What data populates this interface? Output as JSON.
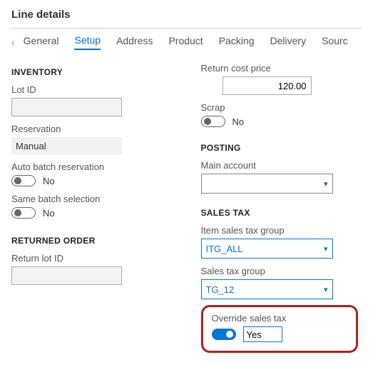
{
  "header": {
    "title": "Line details"
  },
  "tabs": {
    "items": [
      "General",
      "Setup",
      "Address",
      "Product",
      "Packing",
      "Delivery",
      "Sourc"
    ],
    "active_index": 1
  },
  "left": {
    "inventory": {
      "heading": "INVENTORY",
      "lot_id_label": "Lot ID",
      "lot_id_value": "",
      "reservation_label": "Reservation",
      "reservation_value": "Manual",
      "auto_batch_label": "Auto batch reservation",
      "auto_batch_state": "No",
      "same_batch_label": "Same batch selection",
      "same_batch_state": "No"
    },
    "returned_order": {
      "heading": "RETURNED ORDER",
      "return_lot_label": "Return lot ID",
      "return_lot_value": ""
    }
  },
  "right": {
    "return_cost_label": "Return cost price",
    "return_cost_value": "120.00",
    "scrap_label": "Scrap",
    "scrap_state": "No",
    "posting": {
      "heading": "POSTING",
      "main_account_label": "Main account",
      "main_account_value": ""
    },
    "sales_tax": {
      "heading": "SALES TAX",
      "item_group_label": "Item sales tax group",
      "item_group_value": "ITG_ALL",
      "group_label": "Sales tax group",
      "group_value": "TG_12",
      "override_label": "Override sales tax",
      "override_state": "Yes"
    }
  }
}
